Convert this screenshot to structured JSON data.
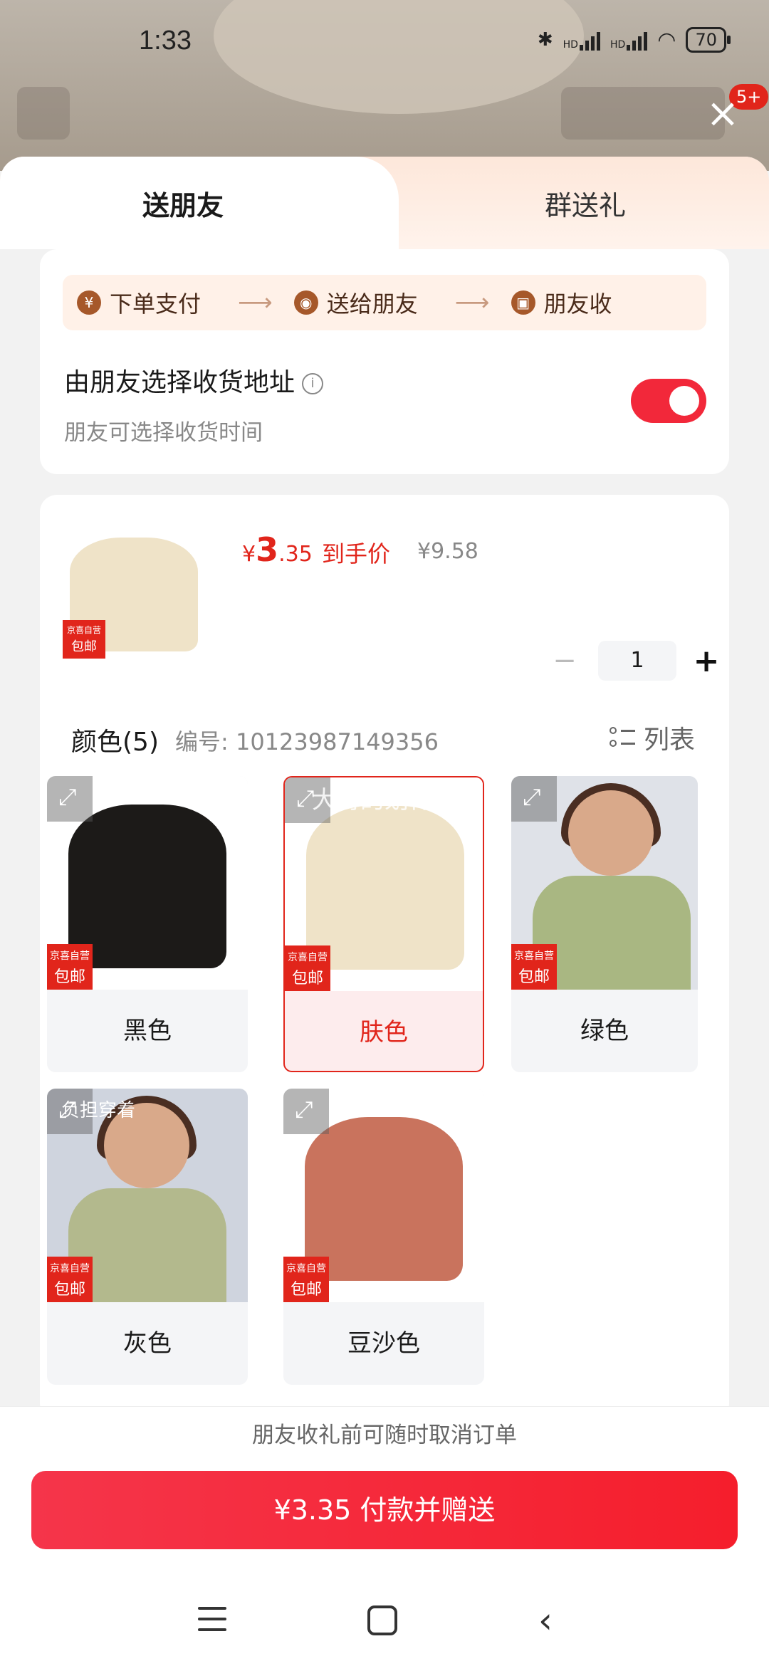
{
  "status": {
    "time": "1:33",
    "network1": "HD",
    "network2": "HD",
    "battery": "70"
  },
  "header": {
    "notification_count": "5+"
  },
  "tabs": [
    {
      "label": "送朋友",
      "active": true
    },
    {
      "label": "群送礼",
      "active": false
    }
  ],
  "steps": [
    {
      "icon": "yen-icon",
      "glyph": "¥",
      "label": "下单支付"
    },
    {
      "icon": "chat-icon",
      "glyph": "◉",
      "label": "送给朋友"
    },
    {
      "icon": "gift-icon",
      "glyph": "▣",
      "label": "朋友收"
    }
  ],
  "address": {
    "title": "由朋友选择收货地址",
    "subtitle": "朋友可选择收货时间",
    "toggle_on": true
  },
  "product": {
    "price_symbol": "¥",
    "price_int": "3",
    "price_dec": ".35",
    "price_label": "到手价",
    "original_price": "¥9.58",
    "quantity": "1",
    "jd_tag_top": "京喜自营",
    "jd_tag_bottom": "包邮"
  },
  "colors": {
    "title": "颜色(5)",
    "sku": "编号: 10123987149356",
    "list_label": "列表",
    "options": [
      {
        "label": "黑色",
        "selected": false,
        "color": "#1c1a18"
      },
      {
        "label": "肤色",
        "selected": true,
        "color": "#efe3c8"
      },
      {
        "label": "绿色",
        "selected": false,
        "color": "#a9b782"
      },
      {
        "label": "灰色",
        "selected": false,
        "color": "#b3b98d"
      },
      {
        "label": "豆沙色",
        "selected": false,
        "color": "#c9735d"
      }
    ],
    "overlay_text_1": "大哥的划得着",
    "overlay_text_2": "负担穿着"
  },
  "notice": "朋友收礼前可随时取消订单",
  "pay_button": "¥3.35 付款并赠送",
  "theme": {
    "accent": "#e1251b",
    "toggle": "#f2283a"
  }
}
